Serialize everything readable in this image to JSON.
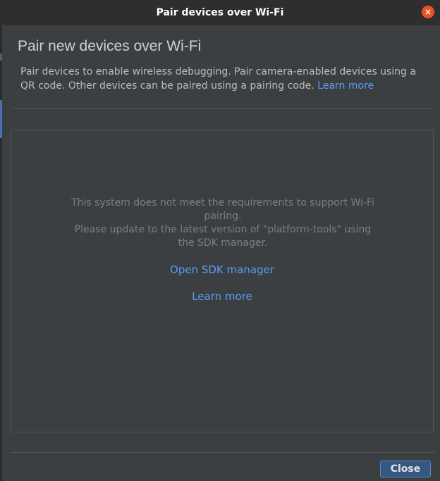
{
  "window": {
    "title": "Pair devices over Wi-Fi",
    "close_glyph": "×"
  },
  "header": {
    "heading": "Pair new devices over Wi-Fi",
    "description": "Pair devices to enable wireless debugging. Pair camera-enabled devices using a QR code. Other devices can be paired using a pairing code.",
    "learn_more": "Learn more"
  },
  "panel": {
    "message_line1": "This system does not meet the requirements to support Wi-Fi pairing.",
    "message_line2": "Please update to the latest version of \"platform-tools\" using the SDK manager.",
    "open_sdk_manager": "Open SDK manager",
    "learn_more": "Learn more"
  },
  "footer": {
    "close_label": "Close"
  },
  "colors": {
    "background": "#3c3f41",
    "link": "#589df6",
    "primary_button": "#365880",
    "window_close": "#e95420"
  }
}
